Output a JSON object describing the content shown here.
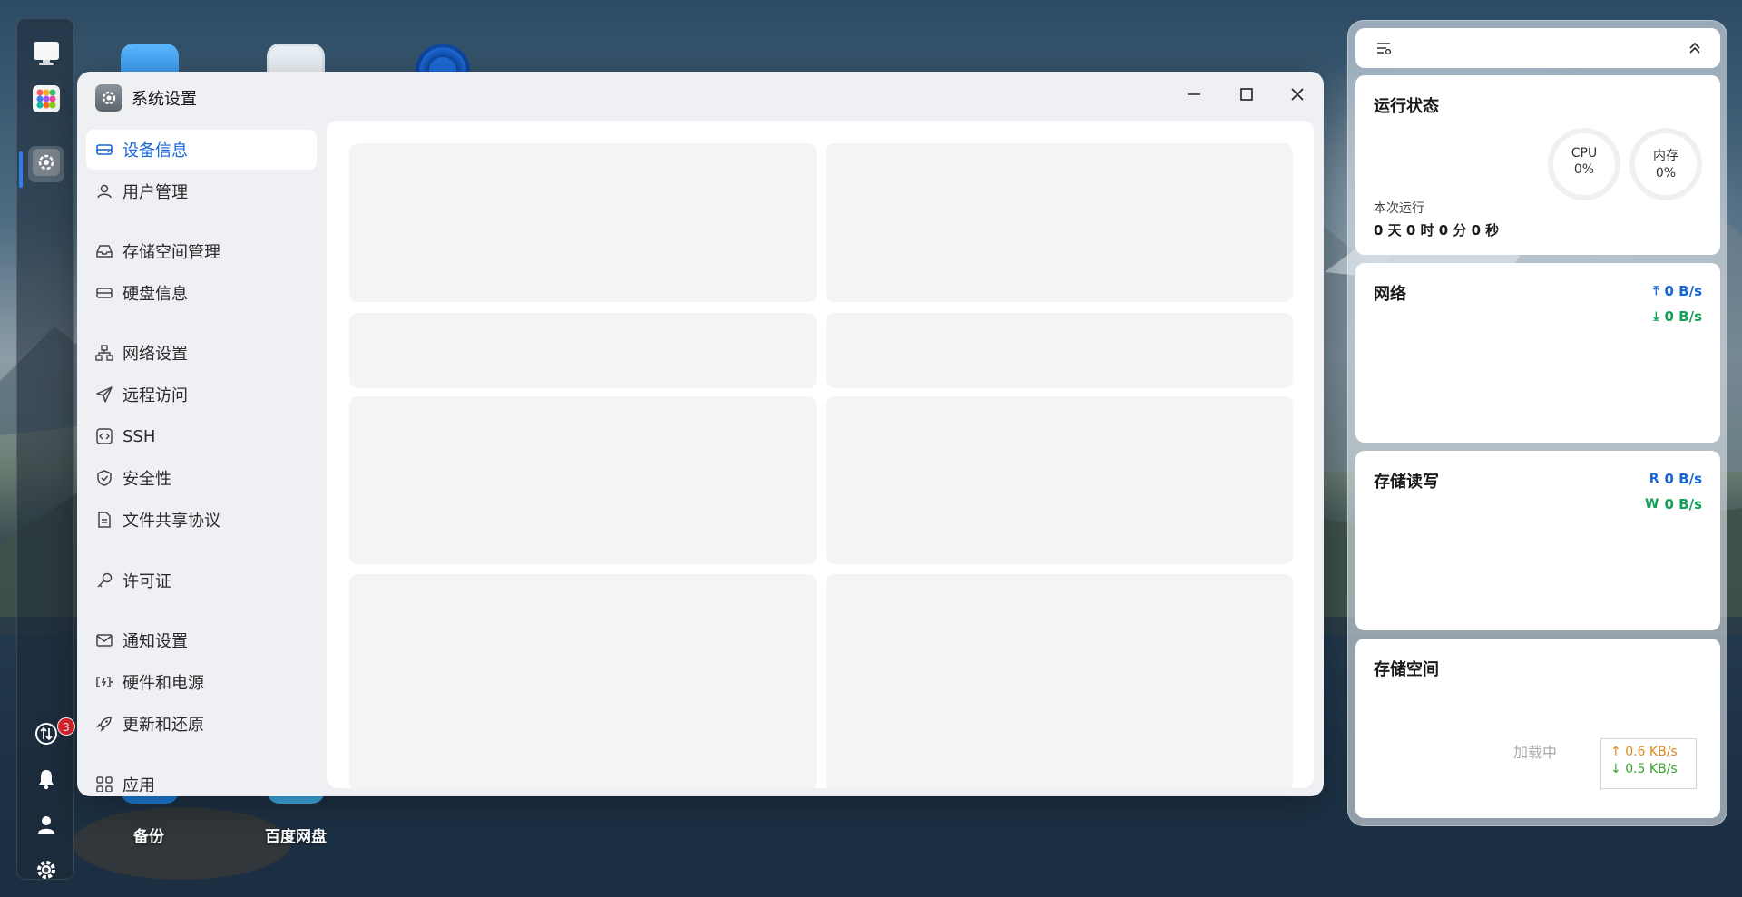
{
  "desktop": {
    "icons": [
      {
        "label": "备份"
      },
      {
        "label": "百度网盘"
      }
    ]
  },
  "dock": {
    "badge_count": "3",
    "active_color": "#2f7cf6"
  },
  "window": {
    "title": "系统设置",
    "nav": [
      {
        "label": "设备信息",
        "icon": "drive-icon",
        "active": true
      },
      {
        "label": "用户管理",
        "icon": "user-icon"
      },
      {
        "label": "存储空间管理",
        "icon": "storage-icon"
      },
      {
        "label": "硬盘信息",
        "icon": "disk-icon"
      },
      {
        "label": "网络设置",
        "icon": "network-icon"
      },
      {
        "label": "远程访问",
        "icon": "send-icon"
      },
      {
        "label": "SSH",
        "icon": "code-icon"
      },
      {
        "label": "安全性",
        "icon": "shield-icon"
      },
      {
        "label": "文件共享协议",
        "icon": "document-icon"
      },
      {
        "label": "许可证",
        "icon": "key-icon"
      },
      {
        "label": "通知设置",
        "icon": "mail-icon"
      },
      {
        "label": "硬件和电源",
        "icon": "battery-icon"
      },
      {
        "label": "更新和还原",
        "icon": "rocket-icon"
      },
      {
        "label": "应用",
        "icon": "apps-icon"
      }
    ]
  },
  "widgets": {
    "status": {
      "title": "运行状态",
      "cpu_label": "CPU",
      "cpu_value": "0%",
      "mem_label": "内存",
      "mem_value": "0%",
      "uptime_label": "本次运行",
      "uptime_value": "0 天 0 时 0 分 0 秒"
    },
    "network": {
      "title": "网络",
      "upload": "0 B/s",
      "download": "0 B/s",
      "upload_color": "#1766d6",
      "download_color": "#15a05a"
    },
    "storage_io": {
      "title": "存储读写",
      "read_label": "R",
      "read_value": "0 B/s",
      "write_label": "W",
      "write_value": "0 B/s"
    },
    "storage_space": {
      "title": "存储空间",
      "loading": "加载中",
      "float_up": "0.6 KB/s",
      "float_down": "0.5 KB/s"
    }
  }
}
